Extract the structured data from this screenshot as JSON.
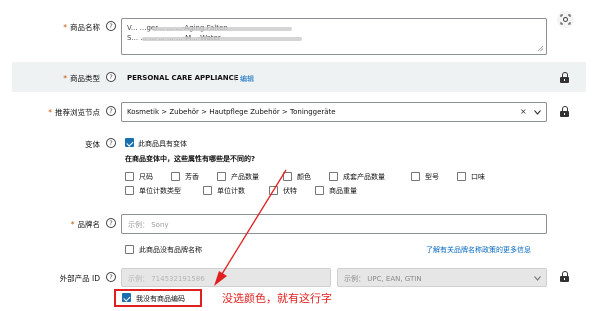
{
  "product_name": {
    "label": "商品名称",
    "value_line1": "V... ...ger... ... ...-Aging Falten",
    "value_line2": "S... ... ... ... ... ...-M...-Water"
  },
  "product_type": {
    "label": "商品类型",
    "value": "PERSONAL CARE APPLIANCE",
    "edit_link": "编辑"
  },
  "browse_node": {
    "label": "推荐浏览节点",
    "value": "Kosmetik > Zubehör > Hautpflege Zubehör > Toninggeräte"
  },
  "variation": {
    "label": "变体",
    "has_variations_label": "此商品具有变体",
    "has_variations_checked": true,
    "question": "在商品变体中，这些属性有哪些是不同的?",
    "options": [
      "尺码",
      "芳香",
      "产品数量",
      "颜色",
      "成套产品数量",
      "型号",
      "口味",
      "单位计数类型",
      "单位计数",
      "伏特",
      "商品重量"
    ]
  },
  "brand": {
    "label": "品牌名",
    "placeholder": "示例：  Sony",
    "no_brand_label": "此商品没有品牌名称",
    "policy_link": "了解有关品牌名称政策的更多信息"
  },
  "external_id": {
    "label": "外部产品 ID",
    "placeholder": "示例：  714532191586",
    "type_placeholder": "示例：  UPC, EAN, GTIN",
    "no_code_label": "我没有商品编码",
    "no_code_checked": true
  },
  "annotation": {
    "text": "没选颜色，就有这行字",
    "color": "#e02020"
  },
  "help_glyph": "?",
  "colors": {
    "accent": "#1a6fb0",
    "link": "#0066c0",
    "required": "#c45500",
    "band": "#eef2f3"
  }
}
